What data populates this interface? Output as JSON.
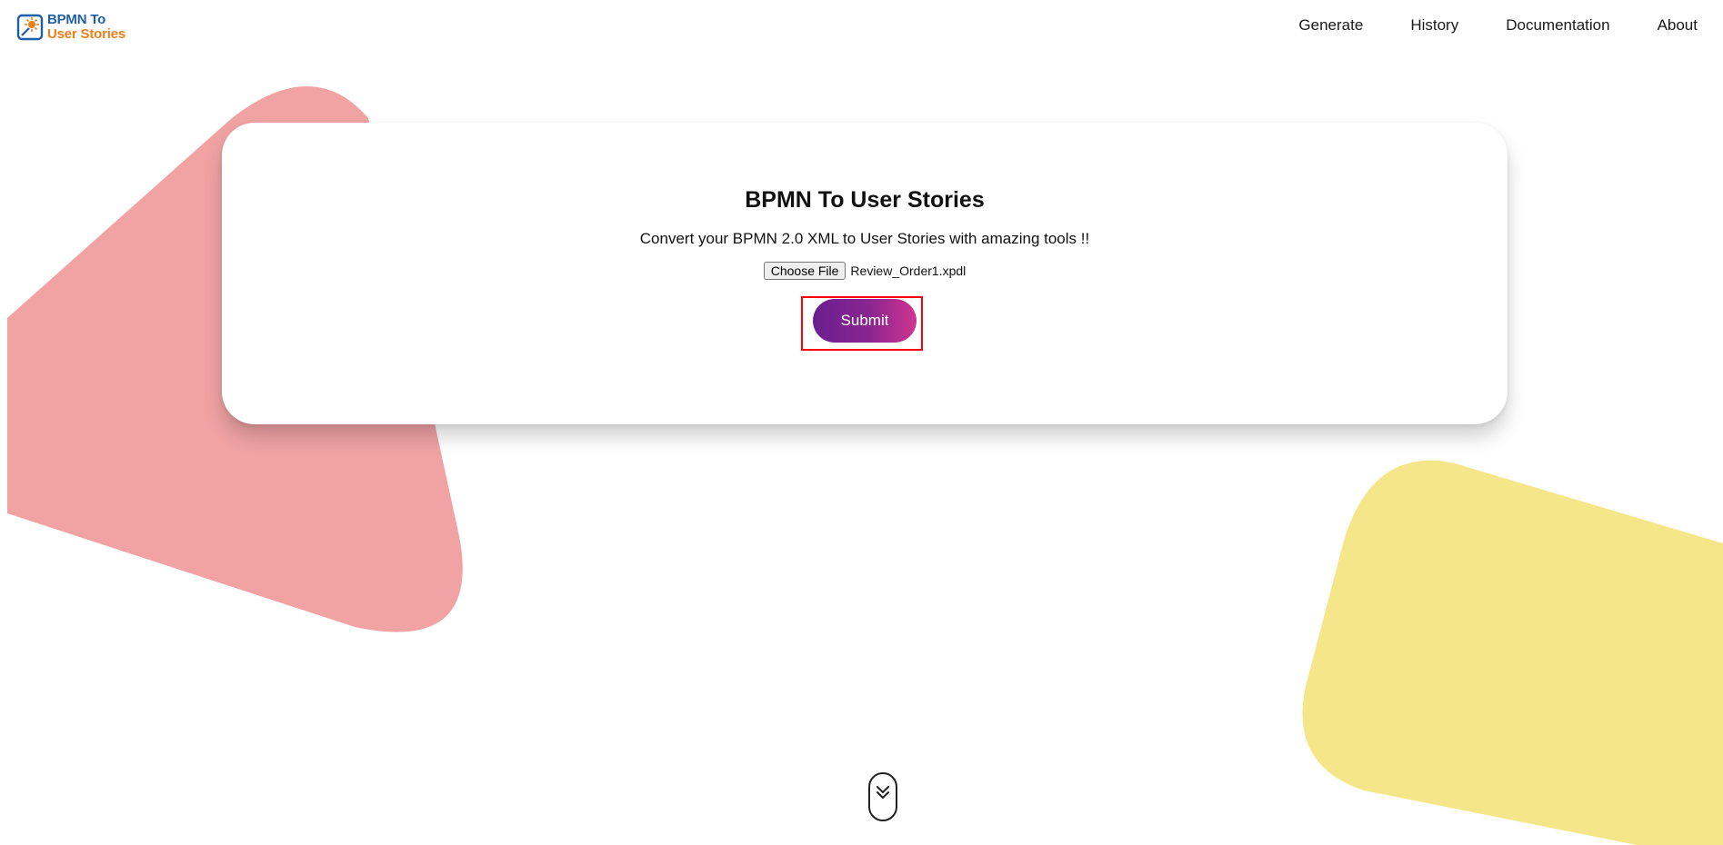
{
  "logo": {
    "line1": "BPMN To",
    "line2": "User Stories",
    "icon": "bpmn-logo-icon"
  },
  "nav": {
    "items": [
      {
        "label": "Generate"
      },
      {
        "label": "History"
      },
      {
        "label": "Documentation"
      },
      {
        "label": "About"
      }
    ]
  },
  "main": {
    "title": "BPMN To User Stories",
    "subtitle": "Convert your BPMN 2.0 XML to User Stories with amazing tools !!",
    "file_input": {
      "button_label": "Choose File",
      "selected_file": "Review_Order1.xpdl"
    },
    "submit_label": "Submit"
  },
  "scroll_indicator": {
    "icon": "double-chevron-down-icon"
  },
  "colors": {
    "logo_blue": "#1f5fa8",
    "logo_orange": "#f07f1a",
    "shape_pink": "#f1a3a4",
    "shape_yellow": "#f6e68a",
    "submit_gradient_start": "#6a1f8f",
    "submit_gradient_end": "#d0358f",
    "highlight_red": "#ff0000"
  }
}
